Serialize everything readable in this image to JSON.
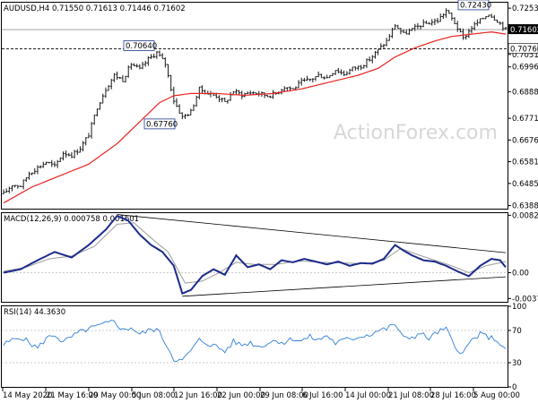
{
  "chart_data": [
    {
      "type": "candlestick",
      "header": "AUDUSD,H4  0.71550 0.71613 0.71446 0.71602",
      "watermark": "ActionForex.com",
      "ylim": [
        0.6375,
        0.7278
      ],
      "y_ticks": [
        0.7254,
        0.7051,
        0.69965,
        0.6888,
        0.6771,
        0.6676,
        0.6581,
        0.64855,
        0.63885
      ],
      "y_tick_labels": [
        "0.72535",
        "0.70510",
        "0.69965",
        "0.68880",
        "0.67710",
        "0.66760",
        "0.65810",
        "0.64855",
        "0.63885"
      ],
      "x_labels": [
        "14 May 2020",
        "21 May 16:00",
        "29 May 00:00",
        "5 Jun 08:00",
        "12 Jun 16:00",
        "22 Jun 00:00",
        "29 Jun 08:00",
        "6 Jul 16:00",
        "14 Jul 00:00",
        "21 Jul 08:00",
        "28 Jul 16:00",
        "5 Aug 00:00"
      ],
      "current_price": 0.716,
      "current_price_label": "0.71602",
      "reference_level": 0.7076,
      "reference_level_label": "0.70760",
      "annotations": [
        {
          "text": "0.72430",
          "value": 0.7243
        },
        {
          "text": "0.70640",
          "value": 0.7064
        },
        {
          "text": "0.67760",
          "value": 0.6776
        }
      ],
      "price_path": [
        [
          0,
          0.644
        ],
        [
          3,
          0.648
        ],
        [
          6,
          0.6475
        ],
        [
          9,
          0.653
        ],
        [
          12,
          0.6555
        ],
        [
          15,
          0.658
        ],
        [
          18,
          0.656
        ],
        [
          21,
          0.662
        ],
        [
          24,
          0.661
        ],
        [
          27,
          0.664
        ],
        [
          30,
          0.67
        ],
        [
          33,
          0.682
        ],
        [
          36,
          0.69
        ],
        [
          39,
          0.696
        ],
        [
          42,
          0.694
        ],
        [
          45,
          0.701
        ],
        [
          48,
          0.6985
        ],
        [
          51,
          0.703
        ],
        [
          54,
          0.706
        ],
        [
          57,
          0.701
        ],
        [
          60,
          0.685
        ],
        [
          63,
          0.6776
        ],
        [
          66,
          0.68
        ],
        [
          69,
          0.69
        ],
        [
          72,
          0.688
        ],
        [
          75,
          0.687
        ],
        [
          78,
          0.684
        ],
        [
          81,
          0.689
        ],
        [
          84,
          0.6875
        ],
        [
          87,
          0.6885
        ],
        [
          90,
          0.688
        ],
        [
          93,
          0.687
        ],
        [
          96,
          0.688
        ],
        [
          99,
          0.691
        ],
        [
          102,
          0.69
        ],
        [
          105,
          0.693
        ],
        [
          108,
          0.694
        ],
        [
          111,
          0.696
        ],
        [
          114,
          0.695
        ],
        [
          117,
          0.6985
        ],
        [
          120,
          0.6965
        ],
        [
          123,
          0.699
        ],
        [
          126,
          0.7
        ],
        [
          129,
          0.703
        ],
        [
          132,
          0.707
        ],
        [
          135,
          0.711
        ],
        [
          138,
          0.718
        ],
        [
          141,
          0.714
        ],
        [
          144,
          0.716
        ],
        [
          147,
          0.718
        ],
        [
          150,
          0.719
        ],
        [
          153,
          0.72
        ],
        [
          156,
          0.7243
        ],
        [
          159,
          0.719
        ],
        [
          162,
          0.712
        ],
        [
          165,
          0.717
        ],
        [
          168,
          0.72
        ],
        [
          171,
          0.723
        ],
        [
          174,
          0.72
        ],
        [
          177,
          0.716
        ]
      ],
      "ma_path": [
        [
          0,
          0.64
        ],
        [
          10,
          0.647
        ],
        [
          20,
          0.652
        ],
        [
          30,
          0.657
        ],
        [
          40,
          0.666
        ],
        [
          50,
          0.678
        ],
        [
          55,
          0.684
        ],
        [
          60,
          0.687
        ],
        [
          66,
          0.688
        ],
        [
          75,
          0.688
        ],
        [
          85,
          0.6872
        ],
        [
          95,
          0.688
        ],
        [
          105,
          0.69
        ],
        [
          115,
          0.693
        ],
        [
          125,
          0.696
        ],
        [
          132,
          0.699
        ],
        [
          138,
          0.704
        ],
        [
          145,
          0.708
        ],
        [
          152,
          0.711
        ],
        [
          158,
          0.713
        ],
        [
          165,
          0.714
        ],
        [
          172,
          0.715
        ],
        [
          177,
          0.714
        ]
      ]
    },
    {
      "type": "line",
      "header": "MACD(12,26,9) 0.000758 0.001601",
      "ylim": [
        -0.0042,
        0.0086
      ],
      "y_ticks": [
        0.008296,
        0.0,
        -0.003725
      ],
      "y_tick_labels": [
        "0.008296",
        "0.00",
        "-0.003725"
      ],
      "macd_path": [
        [
          0,
          0.0
        ],
        [
          6,
          0.0005
        ],
        [
          12,
          0.0018
        ],
        [
          18,
          0.003
        ],
        [
          24,
          0.0022
        ],
        [
          30,
          0.004
        ],
        [
          36,
          0.0062
        ],
        [
          40,
          0.0082
        ],
        [
          44,
          0.0075
        ],
        [
          48,
          0.0055
        ],
        [
          52,
          0.004
        ],
        [
          56,
          0.003
        ],
        [
          60,
          0.001
        ],
        [
          63,
          -0.003
        ],
        [
          66,
          -0.0025
        ],
        [
          70,
          -0.0005
        ],
        [
          74,
          0.0005
        ],
        [
          78,
          -0.0003
        ],
        [
          82,
          0.0025
        ],
        [
          86,
          0.0008
        ],
        [
          90,
          0.0012
        ],
        [
          94,
          0.0005
        ],
        [
          98,
          0.0018
        ],
        [
          102,
          0.0015
        ],
        [
          106,
          0.002
        ],
        [
          110,
          0.0016
        ],
        [
          114,
          0.0012
        ],
        [
          118,
          0.0016
        ],
        [
          122,
          0.001
        ],
        [
          126,
          0.0014
        ],
        [
          130,
          0.0013
        ],
        [
          134,
          0.002
        ],
        [
          138,
          0.004
        ],
        [
          141,
          0.0032
        ],
        [
          144,
          0.0025
        ],
        [
          148,
          0.0018
        ],
        [
          152,
          0.0016
        ],
        [
          156,
          0.001
        ],
        [
          160,
          0.0002
        ],
        [
          164,
          -0.0005
        ],
        [
          168,
          0.001
        ],
        [
          172,
          0.002
        ],
        [
          175,
          0.0018
        ],
        [
          177,
          0.0008
        ]
      ],
      "signal_path": [
        [
          0,
          0.0002
        ],
        [
          8,
          0.0008
        ],
        [
          16,
          0.002
        ],
        [
          24,
          0.0024
        ],
        [
          32,
          0.0038
        ],
        [
          40,
          0.007
        ],
        [
          46,
          0.0072
        ],
        [
          52,
          0.005
        ],
        [
          58,
          0.003
        ],
        [
          64,
          -0.0015
        ],
        [
          70,
          -0.0012
        ],
        [
          76,
          0.0
        ],
        [
          82,
          0.0015
        ],
        [
          88,
          0.0012
        ],
        [
          96,
          0.0012
        ],
        [
          104,
          0.0017
        ],
        [
          112,
          0.0015
        ],
        [
          120,
          0.0014
        ],
        [
          128,
          0.0013
        ],
        [
          134,
          0.0018
        ],
        [
          140,
          0.0035
        ],
        [
          146,
          0.0026
        ],
        [
          152,
          0.0018
        ],
        [
          158,
          0.001
        ],
        [
          164,
          0.0
        ],
        [
          170,
          0.001
        ],
        [
          177,
          0.0016
        ]
      ],
      "trendlines": [
        {
          "from": [
            40,
            0.0084
          ],
          "to": [
            177,
            0.0029
          ]
        },
        {
          "from": [
            63,
            -0.0034
          ],
          "to": [
            177,
            -0.0006
          ]
        }
      ]
    },
    {
      "type": "line",
      "header": "RSI(14) 44.3630",
      "ylim": [
        0,
        100
      ],
      "y_ticks": [
        100,
        70,
        30,
        0
      ],
      "y_tick_labels": [
        "100",
        "70",
        "30",
        "0"
      ],
      "rsi_path": [
        [
          0,
          52
        ],
        [
          3,
          58
        ],
        [
          6,
          62
        ],
        [
          9,
          55
        ],
        [
          12,
          48
        ],
        [
          15,
          60
        ],
        [
          18,
          65
        ],
        [
          21,
          55
        ],
        [
          24,
          62
        ],
        [
          27,
          68
        ],
        [
          30,
          72
        ],
        [
          33,
          75
        ],
        [
          36,
          78
        ],
        [
          39,
          82
        ],
        [
          42,
          70
        ],
        [
          45,
          74
        ],
        [
          48,
          65
        ],
        [
          51,
          70
        ],
        [
          54,
          72
        ],
        [
          57,
          55
        ],
        [
          60,
          35
        ],
        [
          63,
          32
        ],
        [
          66,
          45
        ],
        [
          69,
          58
        ],
        [
          72,
          54
        ],
        [
          75,
          50
        ],
        [
          78,
          44
        ],
        [
          81,
          56
        ],
        [
          84,
          52
        ],
        [
          87,
          55
        ],
        [
          90,
          50
        ],
        [
          93,
          54
        ],
        [
          96,
          58
        ],
        [
          99,
          55
        ],
        [
          102,
          60
        ],
        [
          105,
          57
        ],
        [
          108,
          62
        ],
        [
          111,
          58
        ],
        [
          114,
          64
        ],
        [
          117,
          54
        ],
        [
          120,
          58
        ],
        [
          123,
          60
        ],
        [
          126,
          63
        ],
        [
          129,
          65
        ],
        [
          132,
          70
        ],
        [
          135,
          72
        ],
        [
          138,
          78
        ],
        [
          141,
          60
        ],
        [
          144,
          62
        ],
        [
          147,
          66
        ],
        [
          150,
          60
        ],
        [
          153,
          68
        ],
        [
          156,
          72
        ],
        [
          159,
          50
        ],
        [
          162,
          42
        ],
        [
          165,
          58
        ],
        [
          168,
          65
        ],
        [
          171,
          62
        ],
        [
          174,
          58
        ],
        [
          177,
          44
        ]
      ]
    }
  ]
}
